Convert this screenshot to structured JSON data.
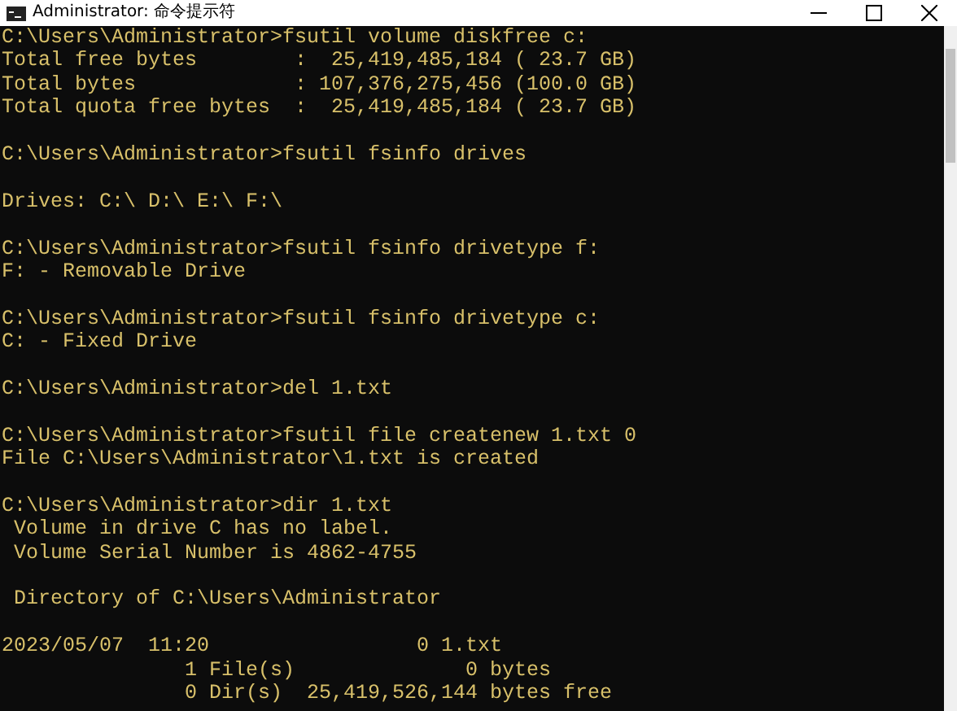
{
  "window": {
    "title": "Administrator: 命令提示符"
  },
  "console": {
    "blocks": [
      [
        "C:\\Users\\Administrator>fsutil volume diskfree c:",
        "Total free bytes        :  25,419,485,184 ( 23.7 GB)",
        "Total bytes             : 107,376,275,456 (100.0 GB)",
        "Total quota free bytes  :  25,419,485,184 ( 23.7 GB)"
      ],
      [
        "C:\\Users\\Administrator>fsutil fsinfo drives"
      ],
      [
        "Drives: C:\\ D:\\ E:\\ F:\\"
      ],
      [
        "C:\\Users\\Administrator>fsutil fsinfo drivetype f:",
        "F: - Removable Drive"
      ],
      [
        "C:\\Users\\Administrator>fsutil fsinfo drivetype c:",
        "C: - Fixed Drive"
      ],
      [
        "C:\\Users\\Administrator>del 1.txt"
      ],
      [
        "C:\\Users\\Administrator>fsutil file createnew 1.txt 0",
        "File C:\\Users\\Administrator\\1.txt is created"
      ],
      [
        "C:\\Users\\Administrator>dir 1.txt",
        " Volume in drive C has no label.",
        " Volume Serial Number is 4862-4755"
      ],
      [
        " Directory of C:\\Users\\Administrator"
      ],
      [
        "2023/05/07  11:20                 0 1.txt",
        "               1 File(s)              0 bytes",
        "               0 Dir(s)  25,419,526,144 bytes free"
      ]
    ]
  }
}
